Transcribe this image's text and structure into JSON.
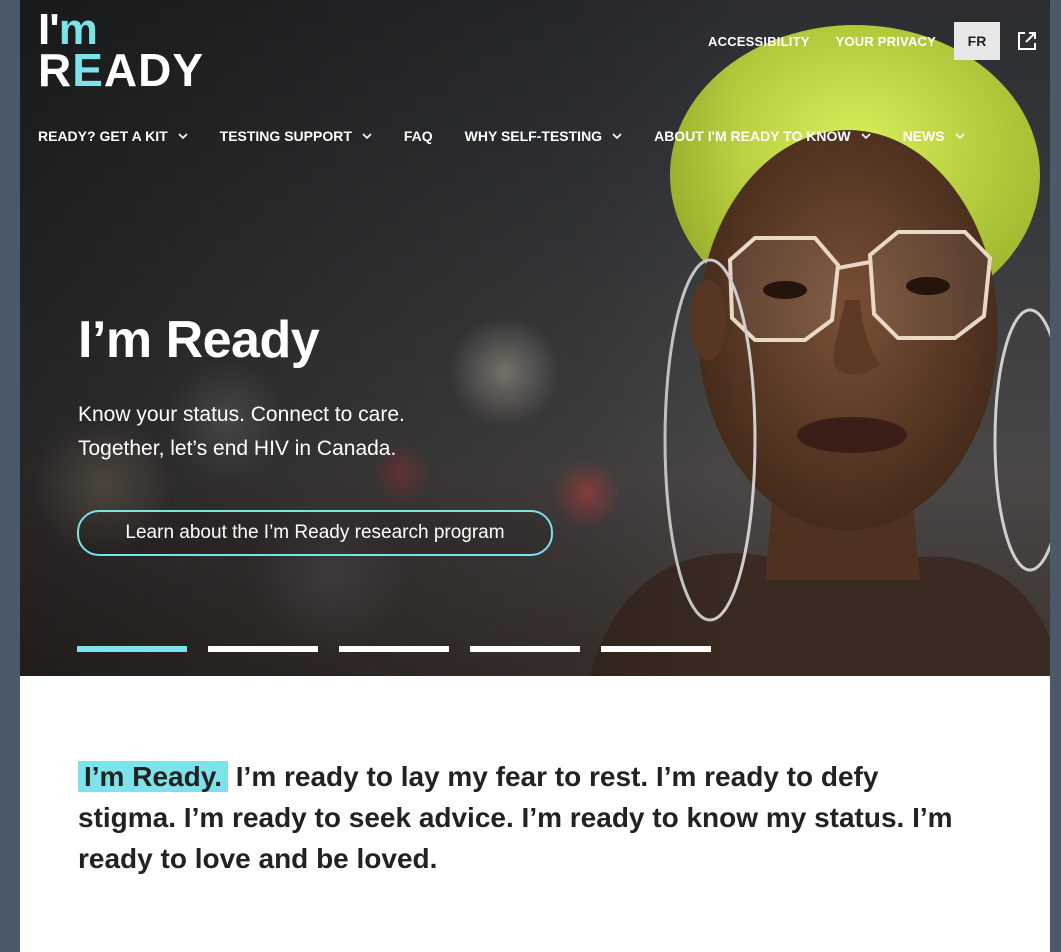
{
  "logo": {
    "line1_a": "I'",
    "line1_b": "m",
    "line2_a": "R",
    "line2_b": "E",
    "line2_c": "ADY"
  },
  "utility": {
    "accessibility": "ACCESSIBILITY",
    "privacy": "YOUR PRIVACY",
    "language": "FR"
  },
  "nav": [
    {
      "label": "READY? GET A KIT",
      "has_dropdown": true
    },
    {
      "label": "TESTING SUPPORT",
      "has_dropdown": true
    },
    {
      "label": "FAQ",
      "has_dropdown": false
    },
    {
      "label": "WHY SELF-TESTING",
      "has_dropdown": true
    },
    {
      "label": "ABOUT I'M READY TO KNOW",
      "has_dropdown": true
    },
    {
      "label": "NEWS",
      "has_dropdown": true
    }
  ],
  "hero": {
    "title": "I’m Ready",
    "subtitle_line1": "Know your status. Connect to care.",
    "subtitle_line2": "Together, let’s end HIV in Canada.",
    "cta": "Learn about the I’m Ready research program",
    "slides": 5,
    "active_slide": 1
  },
  "intro": {
    "highlight": "I’m Ready.",
    "text": "I’m ready to lay my fear to rest. I’m ready to defy stigma. I’m ready to seek advice. I’m ready to know my status. I’m ready to love and be loved."
  },
  "colors": {
    "accent": "#7de3ea",
    "text_dark": "#222222",
    "frame": "#4a5a6b"
  }
}
